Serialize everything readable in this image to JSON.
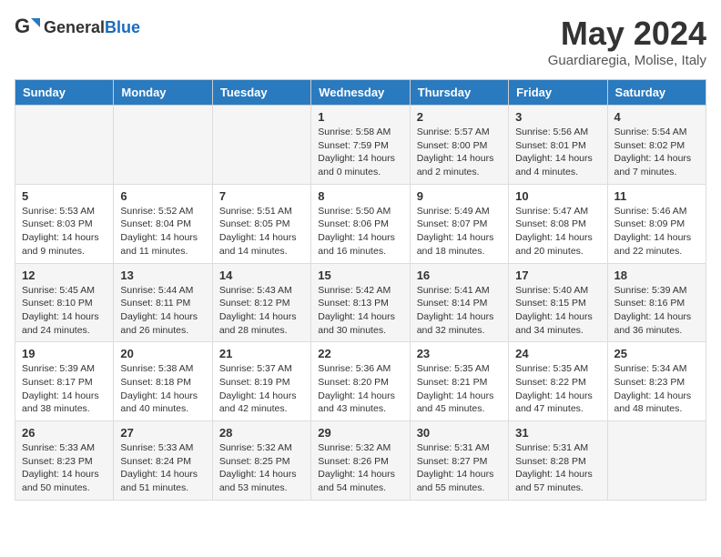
{
  "header": {
    "logo_general": "General",
    "logo_blue": "Blue",
    "month_title": "May 2024",
    "subtitle": "Guardiaregia, Molise, Italy"
  },
  "days_of_week": [
    "Sunday",
    "Monday",
    "Tuesday",
    "Wednesday",
    "Thursday",
    "Friday",
    "Saturday"
  ],
  "weeks": [
    [
      {
        "day": "",
        "info": ""
      },
      {
        "day": "",
        "info": ""
      },
      {
        "day": "",
        "info": ""
      },
      {
        "day": "1",
        "info": "Sunrise: 5:58 AM\nSunset: 7:59 PM\nDaylight: 14 hours\nand 0 minutes."
      },
      {
        "day": "2",
        "info": "Sunrise: 5:57 AM\nSunset: 8:00 PM\nDaylight: 14 hours\nand 2 minutes."
      },
      {
        "day": "3",
        "info": "Sunrise: 5:56 AM\nSunset: 8:01 PM\nDaylight: 14 hours\nand 4 minutes."
      },
      {
        "day": "4",
        "info": "Sunrise: 5:54 AM\nSunset: 8:02 PM\nDaylight: 14 hours\nand 7 minutes."
      }
    ],
    [
      {
        "day": "5",
        "info": "Sunrise: 5:53 AM\nSunset: 8:03 PM\nDaylight: 14 hours\nand 9 minutes."
      },
      {
        "day": "6",
        "info": "Sunrise: 5:52 AM\nSunset: 8:04 PM\nDaylight: 14 hours\nand 11 minutes."
      },
      {
        "day": "7",
        "info": "Sunrise: 5:51 AM\nSunset: 8:05 PM\nDaylight: 14 hours\nand 14 minutes."
      },
      {
        "day": "8",
        "info": "Sunrise: 5:50 AM\nSunset: 8:06 PM\nDaylight: 14 hours\nand 16 minutes."
      },
      {
        "day": "9",
        "info": "Sunrise: 5:49 AM\nSunset: 8:07 PM\nDaylight: 14 hours\nand 18 minutes."
      },
      {
        "day": "10",
        "info": "Sunrise: 5:47 AM\nSunset: 8:08 PM\nDaylight: 14 hours\nand 20 minutes."
      },
      {
        "day": "11",
        "info": "Sunrise: 5:46 AM\nSunset: 8:09 PM\nDaylight: 14 hours\nand 22 minutes."
      }
    ],
    [
      {
        "day": "12",
        "info": "Sunrise: 5:45 AM\nSunset: 8:10 PM\nDaylight: 14 hours\nand 24 minutes."
      },
      {
        "day": "13",
        "info": "Sunrise: 5:44 AM\nSunset: 8:11 PM\nDaylight: 14 hours\nand 26 minutes."
      },
      {
        "day": "14",
        "info": "Sunrise: 5:43 AM\nSunset: 8:12 PM\nDaylight: 14 hours\nand 28 minutes."
      },
      {
        "day": "15",
        "info": "Sunrise: 5:42 AM\nSunset: 8:13 PM\nDaylight: 14 hours\nand 30 minutes."
      },
      {
        "day": "16",
        "info": "Sunrise: 5:41 AM\nSunset: 8:14 PM\nDaylight: 14 hours\nand 32 minutes."
      },
      {
        "day": "17",
        "info": "Sunrise: 5:40 AM\nSunset: 8:15 PM\nDaylight: 14 hours\nand 34 minutes."
      },
      {
        "day": "18",
        "info": "Sunrise: 5:39 AM\nSunset: 8:16 PM\nDaylight: 14 hours\nand 36 minutes."
      }
    ],
    [
      {
        "day": "19",
        "info": "Sunrise: 5:39 AM\nSunset: 8:17 PM\nDaylight: 14 hours\nand 38 minutes."
      },
      {
        "day": "20",
        "info": "Sunrise: 5:38 AM\nSunset: 8:18 PM\nDaylight: 14 hours\nand 40 minutes."
      },
      {
        "day": "21",
        "info": "Sunrise: 5:37 AM\nSunset: 8:19 PM\nDaylight: 14 hours\nand 42 minutes."
      },
      {
        "day": "22",
        "info": "Sunrise: 5:36 AM\nSunset: 8:20 PM\nDaylight: 14 hours\nand 43 minutes."
      },
      {
        "day": "23",
        "info": "Sunrise: 5:35 AM\nSunset: 8:21 PM\nDaylight: 14 hours\nand 45 minutes."
      },
      {
        "day": "24",
        "info": "Sunrise: 5:35 AM\nSunset: 8:22 PM\nDaylight: 14 hours\nand 47 minutes."
      },
      {
        "day": "25",
        "info": "Sunrise: 5:34 AM\nSunset: 8:23 PM\nDaylight: 14 hours\nand 48 minutes."
      }
    ],
    [
      {
        "day": "26",
        "info": "Sunrise: 5:33 AM\nSunset: 8:23 PM\nDaylight: 14 hours\nand 50 minutes."
      },
      {
        "day": "27",
        "info": "Sunrise: 5:33 AM\nSunset: 8:24 PM\nDaylight: 14 hours\nand 51 minutes."
      },
      {
        "day": "28",
        "info": "Sunrise: 5:32 AM\nSunset: 8:25 PM\nDaylight: 14 hours\nand 53 minutes."
      },
      {
        "day": "29",
        "info": "Sunrise: 5:32 AM\nSunset: 8:26 PM\nDaylight: 14 hours\nand 54 minutes."
      },
      {
        "day": "30",
        "info": "Sunrise: 5:31 AM\nSunset: 8:27 PM\nDaylight: 14 hours\nand 55 minutes."
      },
      {
        "day": "31",
        "info": "Sunrise: 5:31 AM\nSunset: 8:28 PM\nDaylight: 14 hours\nand 57 minutes."
      },
      {
        "day": "",
        "info": ""
      }
    ]
  ]
}
